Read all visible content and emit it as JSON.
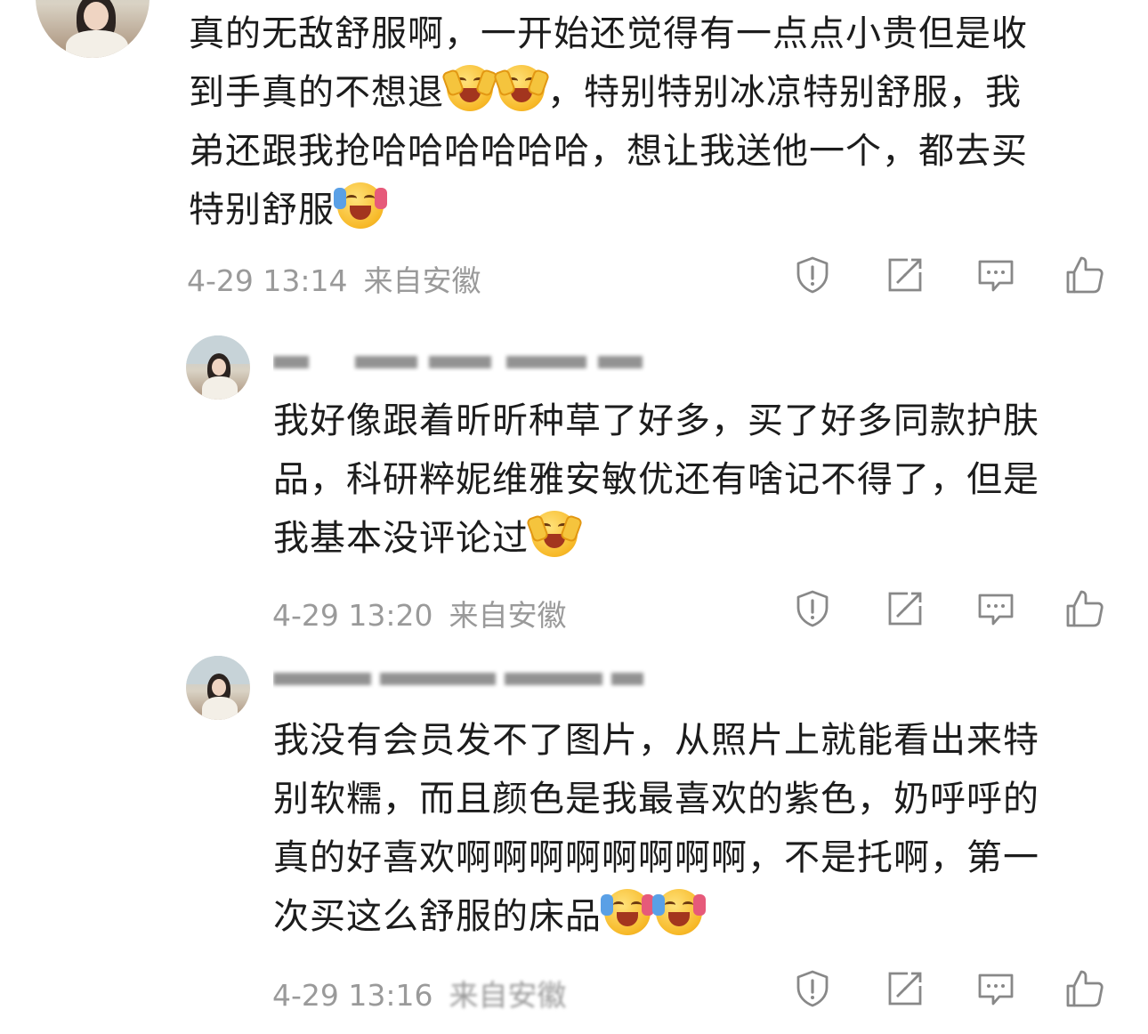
{
  "comments": [
    {
      "lines": [
        [
          {
            "t": "text",
            "v": "真的无敌舒服啊，一开始还觉得有一点点小贵但是收"
          }
        ],
        [
          {
            "t": "text",
            "v": "到手真的不想退"
          },
          {
            "t": "emoji",
            "v": "laugh-cry"
          },
          {
            "t": "emoji",
            "v": "laugh-cry"
          },
          {
            "t": "text",
            "v": "，特别特别冰凉特别舒服，我"
          }
        ],
        [
          {
            "t": "text",
            "v": "弟还跟我抢哈哈哈哈哈哈，想让我送他一个，都去买"
          }
        ],
        [
          {
            "t": "text",
            "v": "特别舒服"
          },
          {
            "t": "emoji",
            "v": "scream"
          }
        ]
      ],
      "date": "4-29 13:14",
      "location": "来自安徽"
    },
    {
      "lines": [
        [
          {
            "t": "text",
            "v": "我好像跟着昕昕种草了好多，买了好多同款护肤"
          }
        ],
        [
          {
            "t": "text",
            "v": "品，科研粹妮维雅安敏优还有啥记不得了，但是"
          }
        ],
        [
          {
            "t": "text",
            "v": "我基本没评论过"
          },
          {
            "t": "emoji",
            "v": "laugh-cry"
          }
        ]
      ],
      "date": "4-29 13:20",
      "location": "来自安徽"
    },
    {
      "lines": [
        [
          {
            "t": "text",
            "v": "我没有会员发不了图片，从照片上就能看出来特"
          }
        ],
        [
          {
            "t": "text",
            "v": "别软糯，而且颜色是我最喜欢的紫色，奶呼呼的"
          }
        ],
        [
          {
            "t": "text",
            "v": "真的好喜欢啊啊啊啊啊啊啊啊，不是托啊，第一"
          }
        ],
        [
          {
            "t": "text",
            "v": "次买这么舒服的床品"
          },
          {
            "t": "emoji",
            "v": "scream"
          },
          {
            "t": "emoji",
            "v": "scream"
          }
        ]
      ],
      "date": "4-29 13:16",
      "location": "来自安徽"
    }
  ],
  "icons": [
    "report-icon",
    "share-icon",
    "comment-icon",
    "like-icon"
  ],
  "colors": {
    "meta": "#9a9a9a",
    "icon": "#888888",
    "text": "#1c1c1c"
  }
}
